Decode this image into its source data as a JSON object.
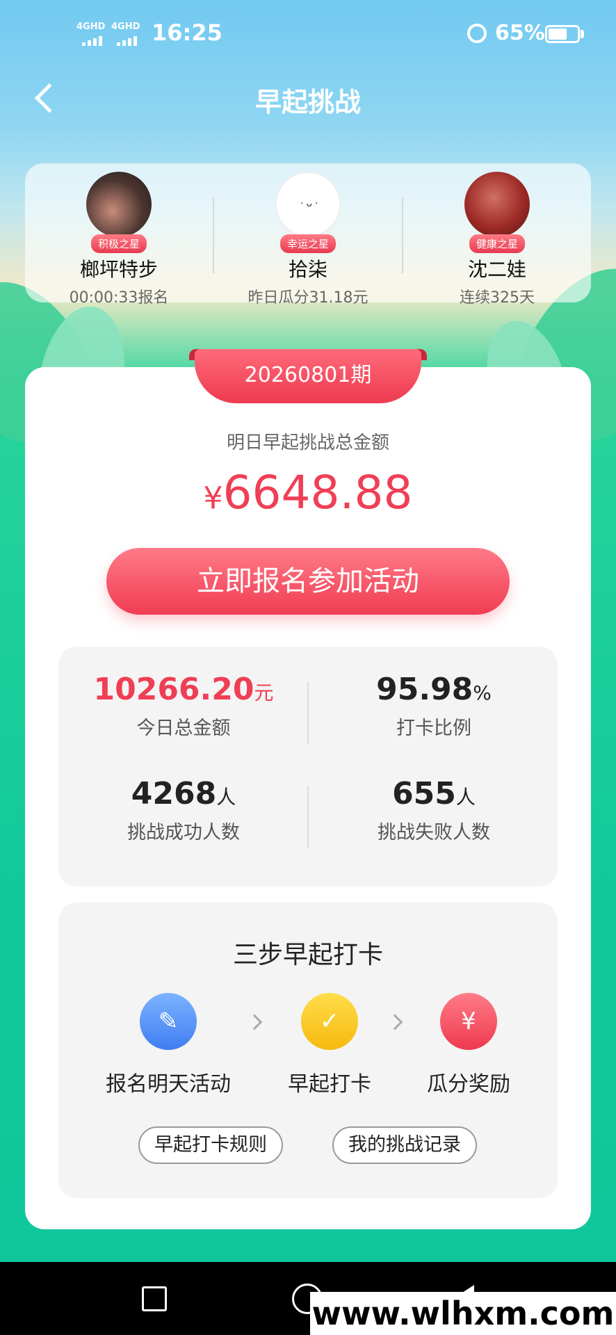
{
  "status_bar": {
    "network1": "4GHD",
    "network2": "4GHD",
    "time": "16:25",
    "battery": "65%",
    "battery_level": 0.65
  },
  "header": {
    "title": "早起挑战",
    "back_icon": "chevron-left-icon"
  },
  "stars": [
    {
      "badge": "积极之星",
      "name": "榔坪特步",
      "sub": "00:00:33报名"
    },
    {
      "badge": "幸运之星",
      "name": "拾柒",
      "sub": "昨日瓜分31.18元"
    },
    {
      "badge": "健康之星",
      "name": "沈二娃",
      "sub": "连续325天"
    }
  ],
  "challenge": {
    "period": "20260801期",
    "pool_label": "明日早起挑战总金额",
    "pool_currency": "¥",
    "pool_amount": "6648.88",
    "join_button": "立即报名参加活动"
  },
  "stats": {
    "today_total_value": "10266.20",
    "today_total_unit": "元",
    "today_total_label": "今日总金额",
    "checkin_ratio_value": "95.98",
    "checkin_ratio_unit": "%",
    "checkin_ratio_label": "打卡比例",
    "success_value": "4268",
    "success_unit": "人",
    "success_label": "挑战成功人数",
    "fail_value": "655",
    "fail_unit": "人",
    "fail_label": "挑战失败人数"
  },
  "steps": {
    "title": "三步早起打卡",
    "items": [
      {
        "label": "报名明天活动",
        "icon": "edit-note-icon"
      },
      {
        "label": "早起打卡",
        "icon": "alarm-clock-icon"
      },
      {
        "label": "瓜分奖励",
        "icon": "red-envelope-icon"
      }
    ],
    "rules_button": "早起打卡规则",
    "records_button": "我的挑战记录"
  },
  "watermark": "www.wlhxm.com",
  "colors": {
    "accent_red": "#ef3f55",
    "sky_blue": "#72c9f1",
    "green": "#10c99a"
  }
}
